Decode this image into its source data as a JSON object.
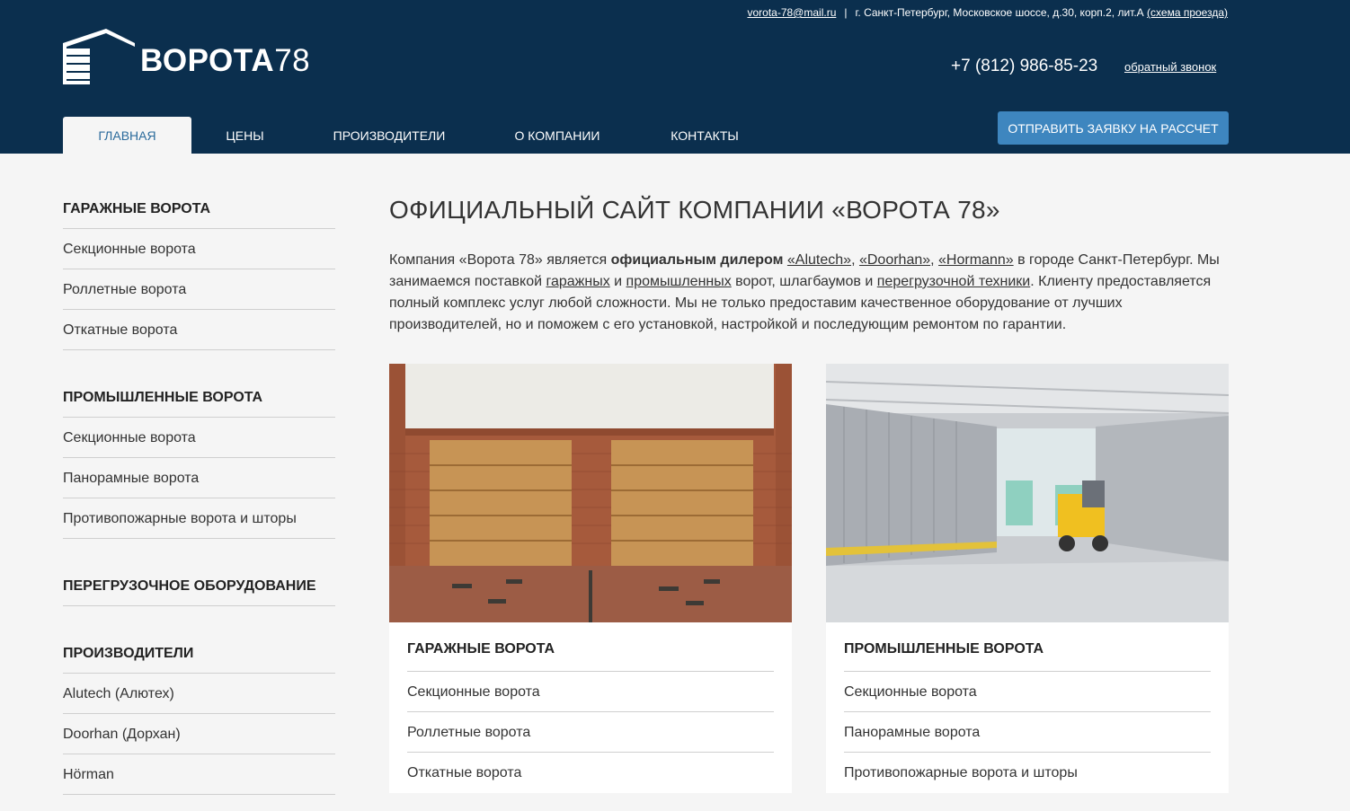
{
  "header": {
    "email": "vorota-78@mail.ru",
    "separator": "|",
    "address": "г. Санкт-Петербург, Московское шоссе, д.30, корп.2, лит.А",
    "route_link": "(схема проезда)",
    "logo_bold": "ВОРОТА",
    "logo_num": "78",
    "phone": "+7 (812) 986-85-23",
    "callback": "обратный звонок",
    "cta": "ОТПРАВИТЬ ЗАЯВКУ НА РАССЧЕТ"
  },
  "nav": [
    {
      "label": "ГЛАВНАЯ",
      "active": true
    },
    {
      "label": "ЦЕНЫ",
      "active": false
    },
    {
      "label": "ПРОИЗВОДИТЕЛИ",
      "active": false
    },
    {
      "label": "О КОМПАНИИ",
      "active": false
    },
    {
      "label": "КОНТАКТЫ",
      "active": false
    }
  ],
  "sidebar": [
    {
      "title": "ГАРАЖНЫЕ ВОРОТА",
      "items": [
        "Секционные ворота",
        "Роллетные ворота",
        "Откатные ворота"
      ]
    },
    {
      "title": "ПРОМЫШЛЕННЫЕ ВОРОТА",
      "items": [
        "Секционные ворота",
        "Панорамные ворота",
        "Противопожарные ворота и шторы"
      ]
    },
    {
      "title": "ПЕРЕГРУЗОЧНОЕ ОБОРУДОВАНИЕ",
      "items": []
    },
    {
      "title": "ПРОИЗВОДИТЕЛИ",
      "items": [
        "Alutech (Алютех)",
        "Doorhan (Дорхан)",
        "Hörman"
      ]
    }
  ],
  "main": {
    "title": "ОФИЦИАЛЬНЫЙ САЙТ КОМПАНИИ «ВОРОТА 78»",
    "intro": {
      "p1": "Компания «Ворота 78» является ",
      "bold": "официальным дилером",
      "sp1": " ",
      "link_alutech": "«Alutech»",
      "comma1": ", ",
      "link_doorhan": "«Doorhan»",
      "comma2": ", ",
      "link_hormann": "«Hormann»",
      "p2": " в городе Санкт-Петербург. Мы занимаемся поставкой ",
      "link_garage": "гаражных",
      "and1": " и ",
      "link_industrial": "промышленных",
      "p3": " ворот, шлагбаумов и ",
      "link_loading": "перегрузочной техники",
      "p4": ". Клиенту предоставляется полный комплекс услуг любой сложности. Мы не только предоставим качественное оборудование от лучших производителей, но и поможем с его установкой, настройкой и последующим ремонтом по гарантии."
    },
    "cards": [
      {
        "title": "ГАРАЖНЫЕ ВОРОТА",
        "items": [
          "Секционные ворота",
          "Роллетные ворота",
          "Откатные ворота"
        ]
      },
      {
        "title": "ПРОМЫШЛЕННЫЕ ВОРОТА",
        "items": [
          "Секционные ворота",
          "Панорамные ворота",
          "Противопожарные ворота и шторы"
        ]
      }
    ]
  },
  "colors": {
    "header_bg": "#0b2f4e",
    "accent": "#3e86bf",
    "active_nav_text": "#2a6a9b"
  }
}
